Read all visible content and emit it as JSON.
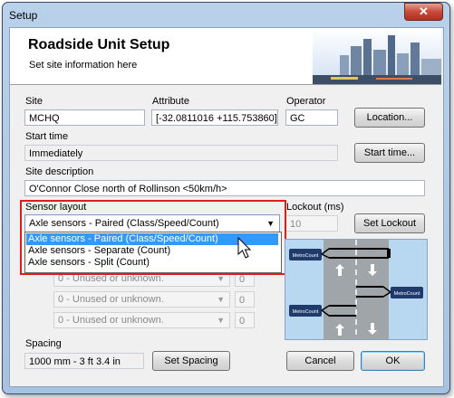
{
  "window": {
    "title": "Setup",
    "close_glyph": "✕"
  },
  "banner": {
    "title": "Roadside Unit Setup",
    "subtitle": "Set site information here"
  },
  "site": {
    "label": "Site",
    "value": "MCHQ"
  },
  "attribute": {
    "label": "Attribute",
    "value": "[-32.0811016 +115.753860]"
  },
  "operator": {
    "label": "Operator",
    "value": "GC"
  },
  "location_button": "Location...",
  "start_time": {
    "label": "Start time",
    "value": "Immediately",
    "button": "Start time..."
  },
  "site_description": {
    "label": "Site description",
    "value": "O'Connor Close north of Rollinson <50km/h>"
  },
  "sensor_layout": {
    "label": "Sensor layout",
    "selected": "Axle sensors - Paired (Class/Speed/Count)",
    "options": [
      "Axle sensors - Paired (Class/Speed/Count)",
      "Axle sensors - Separate (Count)",
      "Axle sensors - Split (Count)"
    ],
    "highlighted_index": 0
  },
  "lockout": {
    "label": "Lockout (ms)",
    "value": "10",
    "button": "Set Lockout"
  },
  "lanes": [
    {
      "value": "0 - Unused or unknown.",
      "count": "0"
    },
    {
      "value": "0 - Unused or unknown.",
      "count": "0"
    },
    {
      "value": "0 - Unused or unknown.",
      "count": "0"
    },
    {
      "value": "0 - Unused or unknown.",
      "count": "0"
    }
  ],
  "spacing": {
    "label": "Spacing",
    "value": "1000 mm - 3 ft 3.4 in",
    "button": "Set Spacing"
  },
  "cancel_button": "Cancel",
  "ok_button": "OK",
  "diagram": {
    "device_label": "MetroCount"
  },
  "colors": {
    "highlight": "#e01c1c",
    "selection": "#3399ff",
    "diagram_bg": "#b8d7f0",
    "road": "#9ea3a8"
  }
}
